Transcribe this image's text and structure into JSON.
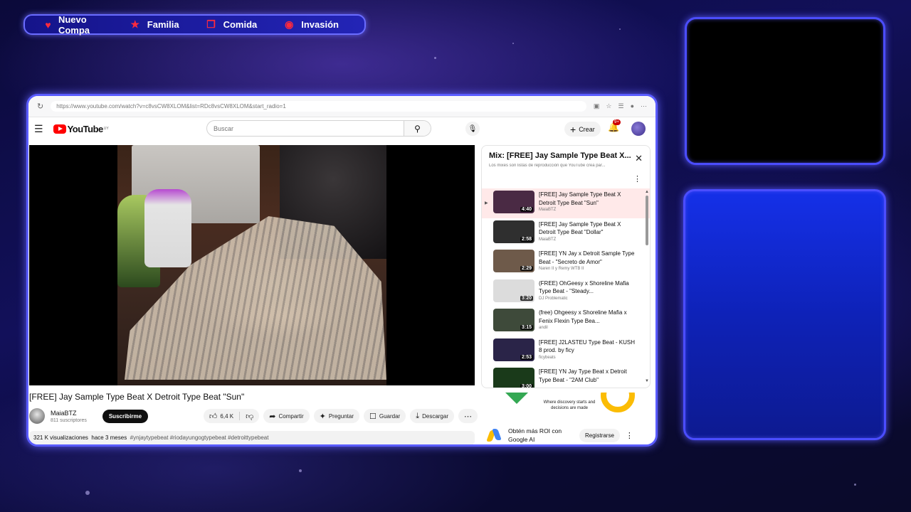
{
  "nav": {
    "items": [
      {
        "label": "Nuevo Compa",
        "icon": "heart-icon",
        "glyph": "♥"
      },
      {
        "label": "Familia",
        "icon": "star-icon",
        "glyph": "★"
      },
      {
        "label": "Comida",
        "icon": "gift-icon",
        "glyph": "❒"
      },
      {
        "label": "Invasión",
        "icon": "invader-icon",
        "glyph": "◉"
      }
    ]
  },
  "browser": {
    "url": "https://www.youtube.com/watch?v=c8vsCW8XLOM&list=RDc8vsCW8XLOM&start_radio=1"
  },
  "youtube": {
    "logo_text": "YouTube",
    "region": "UY",
    "search_placeholder": "Buscar",
    "create_label": "Crear",
    "notifications_badge": "9+"
  },
  "video": {
    "title": "[FREE] Jay Sample Type Beat X Detroit Type Beat \"Sun\"",
    "channel": "MaiaBTZ",
    "subscribers": "811 suscriptores",
    "subscribe_label": "Suscribirme",
    "likes": "6,4 K",
    "share_label": "Compartir",
    "ask_label": "Preguntar",
    "save_label": "Guardar",
    "download_label": "Descargar",
    "views": "321 K visualizaciones",
    "age": "hace 3 meses",
    "tags": "#ynjaytypebeat #riodayungogtypebeat #detroittypebeat"
  },
  "playlist": {
    "title": "Mix: [FREE] Jay Sample Type Beat X...",
    "subtitle": "Los mixes son listas de reproducción que YouTube crea par...",
    "items": [
      {
        "title": "[FREE] Jay Sample Type Beat X Detroit Type Beat \"Sun\"",
        "channel": "MaiaBTZ",
        "duration": "4:40",
        "active": true
      },
      {
        "title": "[FREE] Jay Sample Type Beat X Detroit Type Beat \"Dollar\"",
        "channel": "MaiaBTZ",
        "duration": "2:58"
      },
      {
        "title": "[FREE] YN Jay x Detroit Sample Type Beat - \"Secreto de Amor\"",
        "channel": "Naren II y Remy WTB II",
        "duration": "2:29"
      },
      {
        "title": "(FREE) OhGeesy x Shoreline Mafia Type Beat - \"Steady...",
        "channel": "DJ Problematic",
        "duration": "3:20"
      },
      {
        "title": "(free) Ohgeesy x Shoreline Mafia x Fenix Flexin Type Bea...",
        "channel": "andil",
        "duration": "3:15"
      },
      {
        "title": "[FREE] J2LASTEU Type Beat - KUSH 8 prod. by ficy",
        "channel": "ficybeats",
        "duration": "2:53"
      },
      {
        "title": "[FREE] YN Jay Type Beat x Detroit Type Beat - \"2AM Club\"",
        "channel": "",
        "duration": "3:00"
      }
    ]
  },
  "ad": {
    "banner_text": "Where discovery starts and decisions are made",
    "label": "Obtén más ROI con Google AI",
    "button": "Registrarse"
  },
  "colors": {
    "frame": "#4b4dff",
    "youtube_red": "#ff0000",
    "nav_icon": "#ff2a3d"
  }
}
